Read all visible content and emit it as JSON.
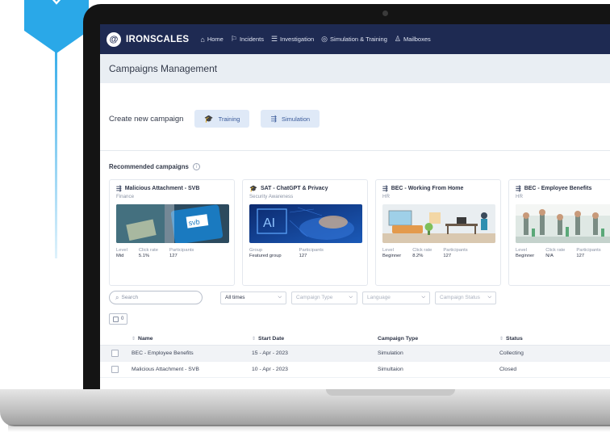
{
  "nav": {
    "brand": "IRONSCALES",
    "logo_glyph": "@",
    "items": [
      {
        "label": "Home",
        "icon": "home-icon",
        "glyph": "⌂"
      },
      {
        "label": "Incidents",
        "icon": "flag-icon",
        "glyph": "⚐"
      },
      {
        "label": "Investigation",
        "icon": "list-icon",
        "glyph": "☰"
      },
      {
        "label": "Simulation & Training",
        "icon": "target-icon",
        "glyph": "◎"
      },
      {
        "label": "Mailboxes",
        "icon": "people-icon",
        "glyph": "♙"
      }
    ]
  },
  "page": {
    "title": "Campaigns Management"
  },
  "create": {
    "label": "Create new campaign",
    "training_label": "Training",
    "training_glyph": "🎓",
    "simulation_label": "Simulation",
    "simulation_glyph": "⇶"
  },
  "recommended": {
    "title": "Recommended campaigns",
    "info_glyph": "i",
    "cards": [
      {
        "title": "Malicious Attachment - SVB",
        "category": "Finance",
        "glyph": "⇶",
        "stats": [
          {
            "key": "Level",
            "value": "Mid"
          },
          {
            "key": "Click rate",
            "value": "5.1%"
          },
          {
            "key": "Participants",
            "value": "127"
          }
        ]
      },
      {
        "title": "SAT - ChatGPT & Privacy",
        "category": "Security Awareness",
        "glyph": "🎓",
        "stats": [
          {
            "key": "Group",
            "value": "Featured group"
          },
          {
            "key": "Participants",
            "value": "127"
          }
        ]
      },
      {
        "title": "BEC - Working From Home",
        "category": "HR",
        "glyph": "⇶",
        "stats": [
          {
            "key": "Level",
            "value": "Beginner"
          },
          {
            "key": "Click rate",
            "value": "8.2%"
          },
          {
            "key": "Participants",
            "value": "127"
          }
        ]
      },
      {
        "title": "BEC - Employee Benefits",
        "category": "HR",
        "glyph": "⇶",
        "stats": [
          {
            "key": "Level",
            "value": "Beginner"
          },
          {
            "key": "Click rate",
            "value": "N/A"
          },
          {
            "key": "Participants",
            "value": "127"
          }
        ]
      }
    ],
    "image_text": {
      "svb": "svb",
      "ai": "AI"
    }
  },
  "filters": {
    "search_placeholder": "Search",
    "time": "All times",
    "campaign_type": "Campaign Type",
    "language": "Language",
    "campaign_status": "Campaign Status",
    "selected_count": "0"
  },
  "table": {
    "columns": [
      "Name",
      "Start Date",
      "Campaign Type",
      "Status"
    ],
    "rows": [
      {
        "name": "BEC - Employee Benefits",
        "start": "15 - Apr - 2023",
        "type": "Simulation",
        "status": "Collecting"
      },
      {
        "name": "Malicious Attachment - SVB",
        "start": "10 - Apr - 2023",
        "type": "Simultaion",
        "status": "Closed"
      }
    ]
  },
  "colors": {
    "nav_bg": "#1e2a52",
    "accent_blue": "#2aa8e8",
    "pill_bg": "#dfe9f7"
  }
}
